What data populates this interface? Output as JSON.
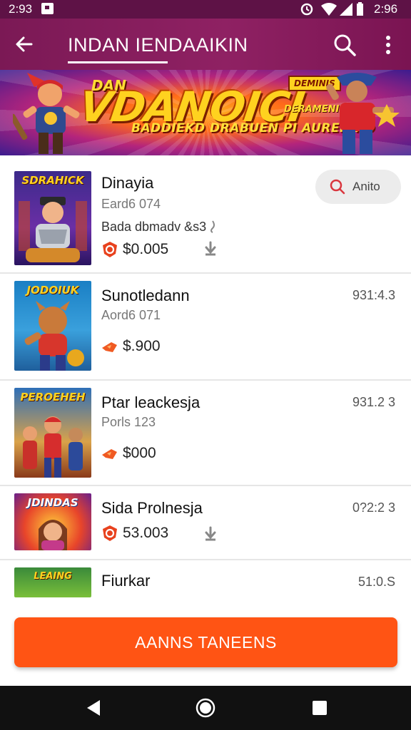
{
  "status_bar": {
    "time_left": "2:93",
    "time_right": "2:96"
  },
  "app_bar": {
    "title": "INDAN IENDAAIKIN"
  },
  "banner": {
    "small_top": "DAN",
    "title": "VDANOICI",
    "tag": "DEMINIS",
    "side_text": "DERAMENIN",
    "subtitle": "BADDIEKD DRABUEN PI AURENIKD"
  },
  "items": [
    {
      "thumb_caption": "SDRAHICK",
      "name": "Dinayia",
      "sub": "Eard6 074",
      "desc": "Bada dbmadv &s3",
      "price": "$0.005",
      "price_icon": "coin-badge-icon",
      "has_download": true,
      "button_label": "Anito",
      "meta": ""
    },
    {
      "thumb_caption": "JODOIUK",
      "name": "Sunotledann",
      "sub": "Aord6 071",
      "desc": "",
      "price": "$.900",
      "price_icon": "fire-tag-icon",
      "has_download": false,
      "button_label": "",
      "meta": "931:4.3"
    },
    {
      "thumb_caption": "PEROEHEH",
      "name": "Ptar leackesja",
      "sub": "Porls 123",
      "desc": "",
      "price": "$000",
      "price_icon": "fire-tag-icon",
      "has_download": false,
      "button_label": "",
      "meta": "931.2 3"
    },
    {
      "thumb_caption": "JDINDAS",
      "name": "Sida Prolnesja",
      "sub": "",
      "desc": "",
      "price": "53.003",
      "price_icon": "coin-badge-icon",
      "has_download": true,
      "button_label": "",
      "meta": "0?2:2 3"
    },
    {
      "thumb_caption": "LEAING",
      "name": "Fiurkar",
      "sub": "",
      "desc": "",
      "price": "",
      "price_icon": "",
      "has_download": false,
      "button_label": "",
      "meta": "51:0.S"
    }
  ],
  "cta": {
    "label": "AANNS TANEENS"
  },
  "colors": {
    "app_bar": "#8a1d5f",
    "status_bar": "#5e1246",
    "accent": "#ff5414",
    "price_icon": "#e8421e"
  }
}
